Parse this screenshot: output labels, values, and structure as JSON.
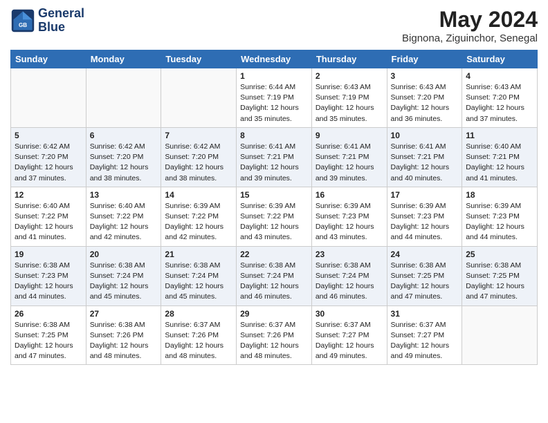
{
  "header": {
    "logo_line1": "General",
    "logo_line2": "Blue",
    "month_title": "May 2024",
    "location": "Bignona, Ziguinchor, Senegal"
  },
  "days_of_week": [
    "Sunday",
    "Monday",
    "Tuesday",
    "Wednesday",
    "Thursday",
    "Friday",
    "Saturday"
  ],
  "weeks": [
    [
      {
        "day": "",
        "info": ""
      },
      {
        "day": "",
        "info": ""
      },
      {
        "day": "",
        "info": ""
      },
      {
        "day": "1",
        "info": "Sunrise: 6:44 AM\nSunset: 7:19 PM\nDaylight: 12 hours and 35 minutes."
      },
      {
        "day": "2",
        "info": "Sunrise: 6:43 AM\nSunset: 7:19 PM\nDaylight: 12 hours and 35 minutes."
      },
      {
        "day": "3",
        "info": "Sunrise: 6:43 AM\nSunset: 7:20 PM\nDaylight: 12 hours and 36 minutes."
      },
      {
        "day": "4",
        "info": "Sunrise: 6:43 AM\nSunset: 7:20 PM\nDaylight: 12 hours and 37 minutes."
      }
    ],
    [
      {
        "day": "5",
        "info": "Sunrise: 6:42 AM\nSunset: 7:20 PM\nDaylight: 12 hours and 37 minutes."
      },
      {
        "day": "6",
        "info": "Sunrise: 6:42 AM\nSunset: 7:20 PM\nDaylight: 12 hours and 38 minutes."
      },
      {
        "day": "7",
        "info": "Sunrise: 6:42 AM\nSunset: 7:20 PM\nDaylight: 12 hours and 38 minutes."
      },
      {
        "day": "8",
        "info": "Sunrise: 6:41 AM\nSunset: 7:21 PM\nDaylight: 12 hours and 39 minutes."
      },
      {
        "day": "9",
        "info": "Sunrise: 6:41 AM\nSunset: 7:21 PM\nDaylight: 12 hours and 39 minutes."
      },
      {
        "day": "10",
        "info": "Sunrise: 6:41 AM\nSunset: 7:21 PM\nDaylight: 12 hours and 40 minutes."
      },
      {
        "day": "11",
        "info": "Sunrise: 6:40 AM\nSunset: 7:21 PM\nDaylight: 12 hours and 41 minutes."
      }
    ],
    [
      {
        "day": "12",
        "info": "Sunrise: 6:40 AM\nSunset: 7:22 PM\nDaylight: 12 hours and 41 minutes."
      },
      {
        "day": "13",
        "info": "Sunrise: 6:40 AM\nSunset: 7:22 PM\nDaylight: 12 hours and 42 minutes."
      },
      {
        "day": "14",
        "info": "Sunrise: 6:39 AM\nSunset: 7:22 PM\nDaylight: 12 hours and 42 minutes."
      },
      {
        "day": "15",
        "info": "Sunrise: 6:39 AM\nSunset: 7:22 PM\nDaylight: 12 hours and 43 minutes."
      },
      {
        "day": "16",
        "info": "Sunrise: 6:39 AM\nSunset: 7:23 PM\nDaylight: 12 hours and 43 minutes."
      },
      {
        "day": "17",
        "info": "Sunrise: 6:39 AM\nSunset: 7:23 PM\nDaylight: 12 hours and 44 minutes."
      },
      {
        "day": "18",
        "info": "Sunrise: 6:39 AM\nSunset: 7:23 PM\nDaylight: 12 hours and 44 minutes."
      }
    ],
    [
      {
        "day": "19",
        "info": "Sunrise: 6:38 AM\nSunset: 7:23 PM\nDaylight: 12 hours and 44 minutes."
      },
      {
        "day": "20",
        "info": "Sunrise: 6:38 AM\nSunset: 7:24 PM\nDaylight: 12 hours and 45 minutes."
      },
      {
        "day": "21",
        "info": "Sunrise: 6:38 AM\nSunset: 7:24 PM\nDaylight: 12 hours and 45 minutes."
      },
      {
        "day": "22",
        "info": "Sunrise: 6:38 AM\nSunset: 7:24 PM\nDaylight: 12 hours and 46 minutes."
      },
      {
        "day": "23",
        "info": "Sunrise: 6:38 AM\nSunset: 7:24 PM\nDaylight: 12 hours and 46 minutes."
      },
      {
        "day": "24",
        "info": "Sunrise: 6:38 AM\nSunset: 7:25 PM\nDaylight: 12 hours and 47 minutes."
      },
      {
        "day": "25",
        "info": "Sunrise: 6:38 AM\nSunset: 7:25 PM\nDaylight: 12 hours and 47 minutes."
      }
    ],
    [
      {
        "day": "26",
        "info": "Sunrise: 6:38 AM\nSunset: 7:25 PM\nDaylight: 12 hours and 47 minutes."
      },
      {
        "day": "27",
        "info": "Sunrise: 6:38 AM\nSunset: 7:26 PM\nDaylight: 12 hours and 48 minutes."
      },
      {
        "day": "28",
        "info": "Sunrise: 6:37 AM\nSunset: 7:26 PM\nDaylight: 12 hours and 48 minutes."
      },
      {
        "day": "29",
        "info": "Sunrise: 6:37 AM\nSunset: 7:26 PM\nDaylight: 12 hours and 48 minutes."
      },
      {
        "day": "30",
        "info": "Sunrise: 6:37 AM\nSunset: 7:27 PM\nDaylight: 12 hours and 49 minutes."
      },
      {
        "day": "31",
        "info": "Sunrise: 6:37 AM\nSunset: 7:27 PM\nDaylight: 12 hours and 49 minutes."
      },
      {
        "day": "",
        "info": ""
      }
    ]
  ]
}
